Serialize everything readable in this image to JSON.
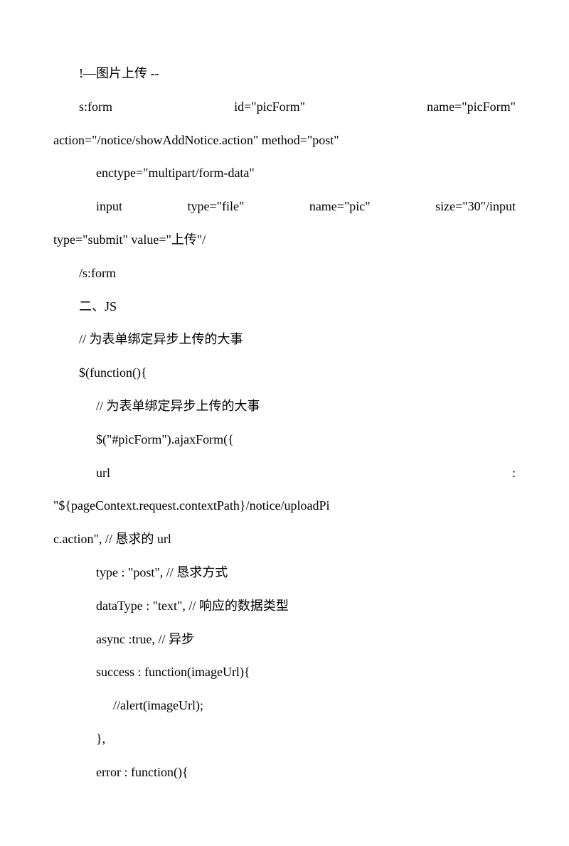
{
  "lines": {
    "l1": "!—图片上传 --",
    "l2a": "s:form",
    "l2b": "id=\"picForm\"",
    "l2c": "name=\"picForm\"",
    "l3": "action=\"/notice/showAddNotice.action\" method=\"post\"",
    "l4": "enctype=\"multipart/form-data\"",
    "l5a": "input",
    "l5b": "type=\"file\"",
    "l5c": "name=\"pic\"",
    "l5d": "size=\"30\"/input",
    "l6": "type=\"submit\" value=\"上传\"/",
    "l7": "/s:form",
    "l8": "二、JS",
    "l9": "// 为表单绑定异步上传的大事",
    "l10": "$(function(){",
    "l11": "// 为表单绑定异步上传的大事",
    "l12": "$(\"#picForm\").ajaxForm({",
    "l13a": "url",
    "l13b": ":",
    "l14": "\"${pageContext.request.contextPath}/notice/uploadPi",
    "l15": "c.action\", // 恳求的 url",
    "l16": "type : \"post\", // 恳求方式",
    "l17": "dataType : \"text\", // 响应的数据类型",
    "l18": "async :true, // 异步",
    "l19": "success : function(imageUrl){",
    "l20": "//alert(imageUrl);",
    "l21": "},",
    "l22": "error : function(){"
  }
}
